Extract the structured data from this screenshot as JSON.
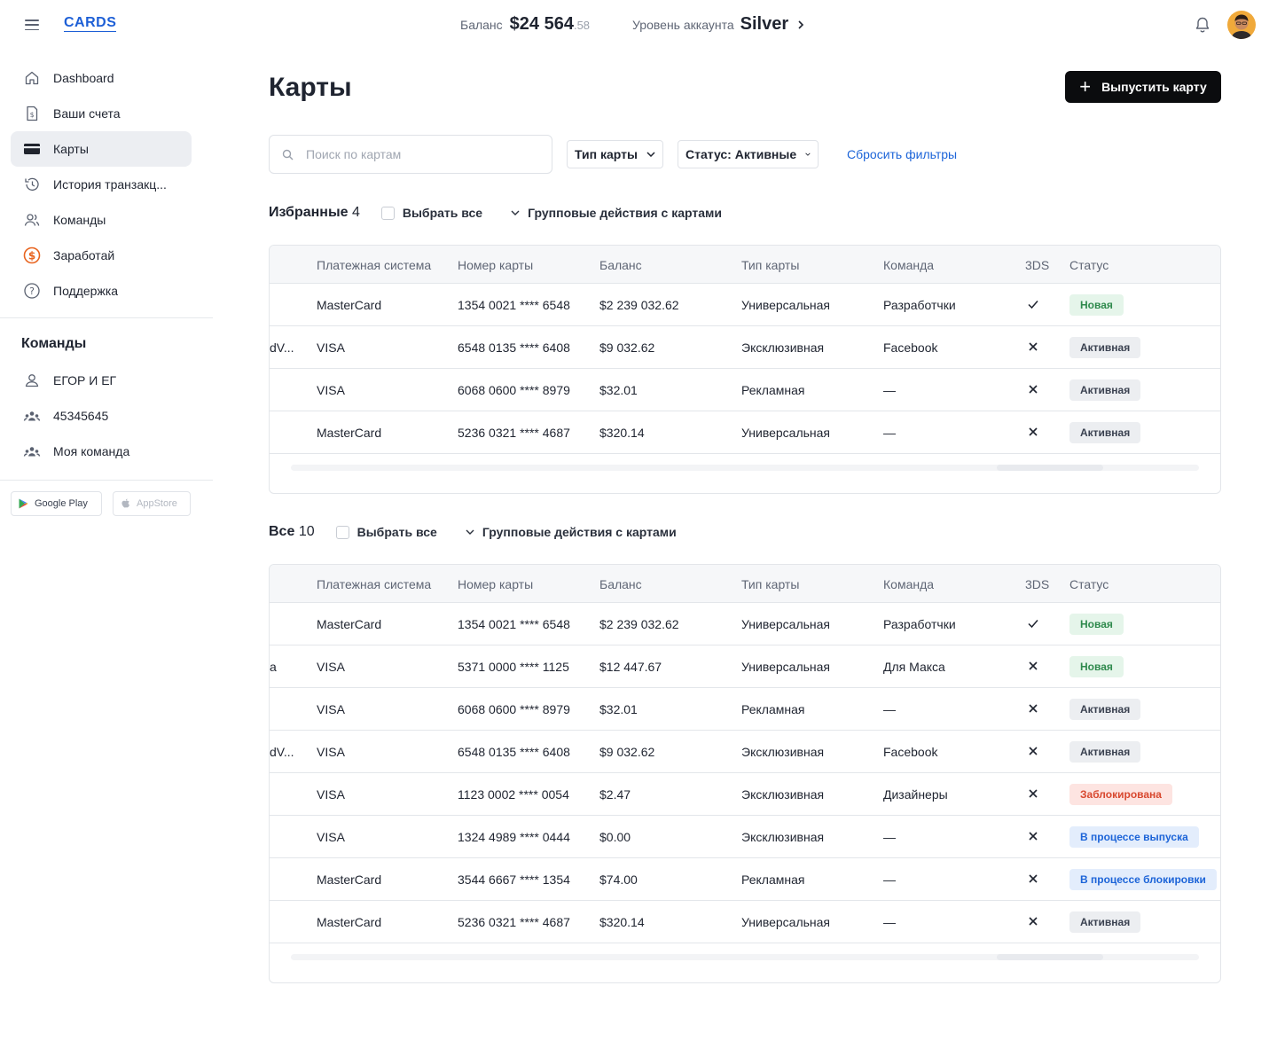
{
  "header": {
    "logo": "CARDS",
    "balance_label": "Баланс",
    "balance_main": "$24 564",
    "balance_cents": ".58",
    "level_label": "Уровень аккаунта",
    "level_value": "Silver"
  },
  "sidebar": {
    "nav": [
      {
        "label": "Dashboard",
        "icon": "home-icon"
      },
      {
        "label": "Ваши счета",
        "icon": "invoice-icon"
      },
      {
        "label": "Карты",
        "icon": "card-icon",
        "active": true
      },
      {
        "label": "История транзакц...",
        "icon": "history-icon"
      },
      {
        "label": "Команды",
        "icon": "team-icon"
      },
      {
        "label": "Заработай",
        "icon": "dollar-icon"
      },
      {
        "label": "Поддержка",
        "icon": "help-icon"
      }
    ],
    "teams_title": "Команды",
    "teams": [
      {
        "label": "ЕГОР И ЕГ",
        "icon": "user-icon"
      },
      {
        "label": "45345645",
        "icon": "group-icon"
      },
      {
        "label": "Моя команда",
        "icon": "group-icon"
      }
    ],
    "stores": {
      "google": "Google Play",
      "apple": "AppStore"
    }
  },
  "main": {
    "title": "Карты",
    "issue_button": "Выпустить карту",
    "search_placeholder": "Поиск по картам",
    "filter_type": "Тип карты",
    "filter_status": "Статус: Активные",
    "reset_filters": "Сбросить фильтры",
    "select_all": "Выбрать все",
    "group_actions": "Групповые действия с картами",
    "columns": [
      "Платежная система",
      "Номер карты",
      "Баланс",
      "Тип карты",
      "Команда",
      "3DS",
      "Статус"
    ],
    "favorites": {
      "title": "Избранные",
      "count": "4",
      "rows": [
        {
          "cut": "",
          "system": "MasterCard",
          "number": "1354 0021 **** 6548",
          "balance": "$2 239 032.62",
          "type": "Универсальная",
          "team": "Разработчки",
          "ds": true,
          "status": "Новая",
          "status_kind": "new"
        },
        {
          "cut": "dV...",
          "system": "VISA",
          "number": "6548 0135 **** 6408",
          "balance": "$9 032.62",
          "type": "Эксклюзивная",
          "team": "Facebook",
          "ds": false,
          "status": "Активная",
          "status_kind": "active"
        },
        {
          "cut": "",
          "system": "VISA",
          "number": "6068 0600 **** 8979",
          "balance": "$32.01",
          "type": "Рекламная",
          "team": "—",
          "ds": false,
          "status": "Активная",
          "status_kind": "active"
        },
        {
          "cut": "",
          "system": "MasterCard",
          "number": "5236 0321 **** 4687",
          "balance": "$320.14",
          "type": "Универсальная",
          "team": "—",
          "ds": false,
          "status": "Активная",
          "status_kind": "active"
        }
      ]
    },
    "all": {
      "title": "Все",
      "count": "10",
      "rows": [
        {
          "cut": "",
          "system": "MasterCard",
          "number": "1354 0021 **** 6548",
          "balance": "$2 239 032.62",
          "type": "Универсальная",
          "team": "Разработчки",
          "ds": true,
          "status": "Новая",
          "status_kind": "new"
        },
        {
          "cut": "a",
          "system": "VISA",
          "number": "5371 0000 **** 1125",
          "balance": "$12 447.67",
          "type": "Универсальная",
          "team": "Для Макса",
          "ds": false,
          "status": "Новая",
          "status_kind": "new"
        },
        {
          "cut": "",
          "system": "VISA",
          "number": "6068 0600 **** 8979",
          "balance": "$32.01",
          "type": "Рекламная",
          "team": "—",
          "ds": false,
          "status": "Активная",
          "status_kind": "active"
        },
        {
          "cut": "dV...",
          "system": "VISA",
          "number": "6548 0135 **** 6408",
          "balance": "$9 032.62",
          "type": "Эксклюзивная",
          "team": "Facebook",
          "ds": false,
          "status": "Активная",
          "status_kind": "active"
        },
        {
          "cut": "",
          "system": "VISA",
          "number": "1123 0002 **** 0054",
          "balance": "$2.47",
          "type": "Эксклюзивная",
          "team": "Дизайнеры",
          "ds": false,
          "status": "Заблокирована",
          "status_kind": "blocked"
        },
        {
          "cut": "",
          "system": "VISA",
          "number": "1324 4989 **** 0444",
          "balance": "$0.00",
          "type": "Эксклюзивная",
          "team": "—",
          "ds": false,
          "status": "В процессе выпуска",
          "status_kind": "process"
        },
        {
          "cut": "",
          "system": "MasterCard",
          "number": "3544 6667 **** 1354",
          "balance": "$74.00",
          "type": "Рекламная",
          "team": "—",
          "ds": false,
          "status": "В процессе блокировки",
          "status_kind": "process"
        },
        {
          "cut": "",
          "system": "MasterCard",
          "number": "5236 0321 **** 4687",
          "balance": "$320.14",
          "type": "Универсальная",
          "team": "—",
          "ds": false,
          "status": "Активная",
          "status_kind": "active"
        }
      ]
    }
  },
  "colors": {
    "accent": "#1c64d8",
    "new_bg": "#e5f5ea",
    "new_fg": "#2f8a4d",
    "active_bg": "#eceef1",
    "active_fg": "#3a4150",
    "blocked_bg": "#fde4e1",
    "blocked_fg": "#d8482f",
    "process_bg": "#e3edfc",
    "process_fg": "#1c64d8"
  }
}
